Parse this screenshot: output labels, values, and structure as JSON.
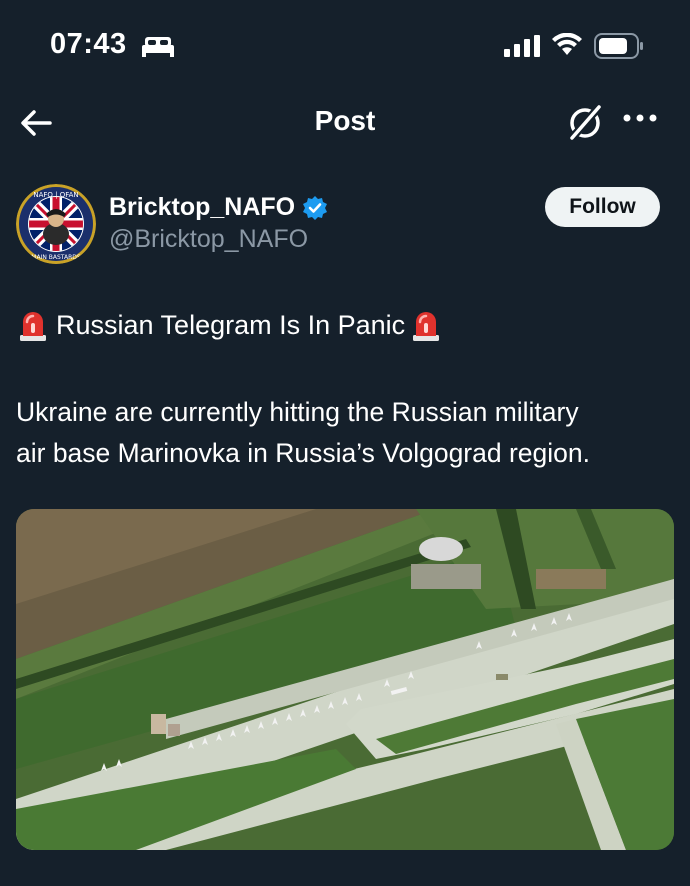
{
  "status_bar": {
    "time": "07:43",
    "icons": [
      "bed-icon",
      "signal-icon",
      "wifi-icon",
      "battery-icon"
    ]
  },
  "nav": {
    "title": "Post",
    "icons": [
      "back-arrow-icon",
      "grok-icon",
      "more-icon"
    ]
  },
  "author": {
    "display_name": "Bricktop_NAFO",
    "handle": "@Bricktop_NAFO",
    "verified": true,
    "follow_label": "Follow",
    "avatar_text_top": "NAFO | OFAN",
    "avatar_text_bottom": "MAIN BASTARDS"
  },
  "post": {
    "headline": "Russian Telegram Is In Panic",
    "body_line1": "Ukraine are currently hitting the Russian military",
    "body_line2": "air base Marinovka in Russia’s Volgograd region."
  },
  "media": {
    "type": "satellite-image",
    "subject": "airbase-runway-aircraft"
  },
  "colors": {
    "background": "#15202b",
    "secondary_text": "#8b98a5",
    "verified_blue": "#1d9bf0",
    "follow_bg": "#eff3f4"
  }
}
